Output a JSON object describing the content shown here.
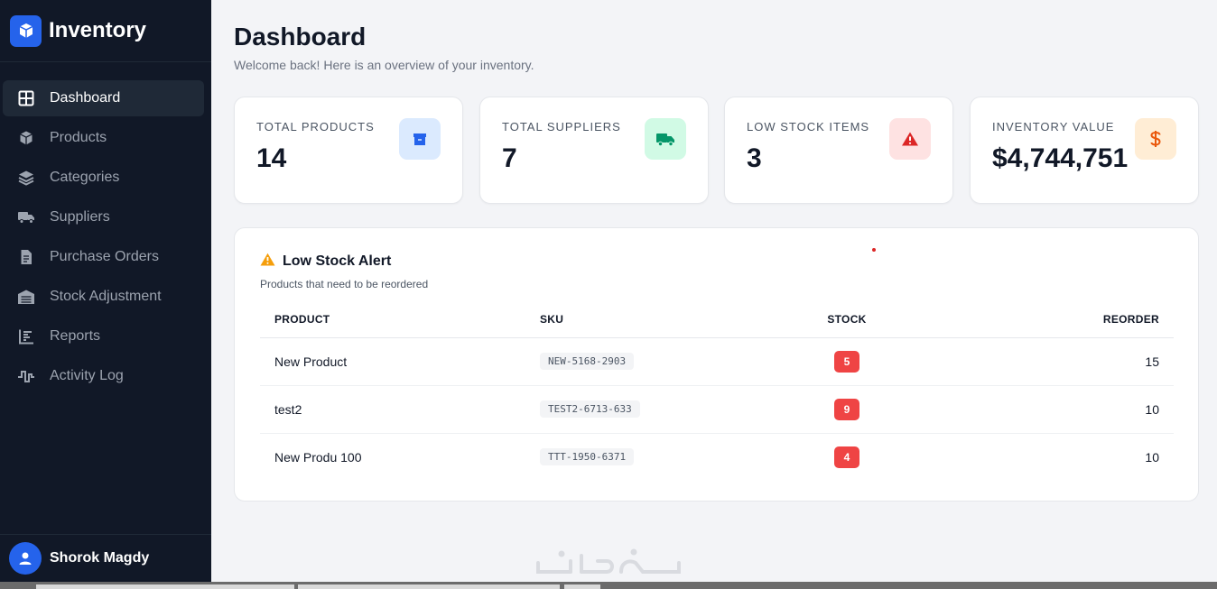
{
  "app": {
    "title": "Inventory"
  },
  "sidebar": {
    "items": [
      {
        "label": "Dashboard",
        "icon": "grid-icon",
        "active": true
      },
      {
        "label": "Products",
        "icon": "box-icon"
      },
      {
        "label": "Categories",
        "icon": "layers-icon"
      },
      {
        "label": "Suppliers",
        "icon": "truck-icon"
      },
      {
        "label": "Purchase Orders",
        "icon": "document-icon"
      },
      {
        "label": "Stock Adjustment",
        "icon": "warehouse-icon"
      },
      {
        "label": "Reports",
        "icon": "bar-chart-icon"
      },
      {
        "label": "Activity Log",
        "icon": "activity-icon"
      }
    ]
  },
  "user": {
    "name": "Shorok Magdy"
  },
  "page": {
    "title": "Dashboard",
    "subtitle": "Welcome back! Here is an overview of your inventory."
  },
  "stats": [
    {
      "label": "TOTAL PRODUCTS",
      "value": "14",
      "icon": "box-icon",
      "color": "#2563eb",
      "bg": "#dbeafe"
    },
    {
      "label": "TOTAL SUPPLIERS",
      "value": "7",
      "icon": "truck-icon",
      "color": "#10b981",
      "bg": "#d1fae5"
    },
    {
      "label": "LOW STOCK ITEMS",
      "value": "3",
      "icon": "warning-icon",
      "color": "#dc2626",
      "bg": "#fee2e2"
    },
    {
      "label": "INVENTORY VALUE",
      "value": "$4,744,751",
      "icon": "dollar-icon",
      "color": "#ea580c",
      "bg": "#ffedd5"
    }
  ],
  "low_stock": {
    "title": "Low Stock Alert",
    "subtitle": "Products that need to be reordered",
    "columns": {
      "product": "PRODUCT",
      "sku": "SKU",
      "stock": "STOCK",
      "reorder": "REORDER"
    },
    "rows": [
      {
        "product": "New Product",
        "sku": "NEW-5168-2903",
        "stock": "5",
        "reorder": "15"
      },
      {
        "product": "test2",
        "sku": "TEST2-6713-633",
        "stock": "9",
        "reorder": "10"
      },
      {
        "product": "New Produ 100",
        "sku": "TTT-1950-6371",
        "stock": "4",
        "reorder": "10"
      }
    ]
  },
  "colors": {
    "sidebar_bg": "#111827",
    "accent": "#2563eb",
    "danger": "#ef4444",
    "warning": "#f59e0b"
  }
}
